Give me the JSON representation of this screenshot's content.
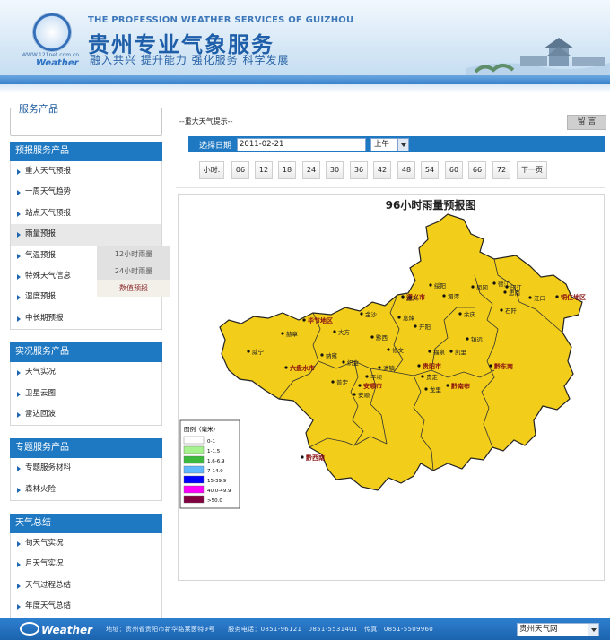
{
  "header": {
    "site_url": "WWW.121net.com.cn",
    "logo_text": "Weather",
    "title_en": "THE PROFESSION WEATHER SERVICES OF GUIZHOU",
    "title_cn": "贵州专业气象服务",
    "slogan": "融入共兴 提升能力 强化服务 科学发展"
  },
  "sidebar": {
    "service_box_title": "服务产品",
    "sections": [
      {
        "title": "预报服务产品",
        "items": [
          "重大天气预报",
          "一周天气趋势",
          "站点天气预报",
          "雨量预报",
          "气温预报",
          "特殊天气信息",
          "湿度预报",
          "中长期预报"
        ]
      },
      {
        "title": "实况服务产品",
        "items": [
          "天气实况",
          "卫星云图",
          "雷达回波"
        ]
      },
      {
        "title": "专题服务产品",
        "items": [
          "专题服务材料",
          "森林火险"
        ]
      },
      {
        "title": "天气总结",
        "items": [
          "旬天气实况",
          "月天气实况",
          "天气过程总结",
          "年度天气总结"
        ]
      }
    ],
    "flyout": [
      "12小时雨量",
      "24小时雨量",
      "数值预报"
    ]
  },
  "main": {
    "breadcrumb": "--重大天气提示--",
    "message_button": "留 言",
    "date_label": "选择日期",
    "date_value": "2011-02-21",
    "period_value": "上午",
    "hours_label": "小时:",
    "hours": [
      "06",
      "12",
      "18",
      "24",
      "30",
      "36",
      "42",
      "48",
      "54",
      "60",
      "66",
      "72"
    ],
    "next_page": "下一页"
  },
  "map": {
    "title": "96小时雨量预报图",
    "legend_title": "图例（毫米）",
    "legend": [
      {
        "label": "0-1",
        "color": "#ffffff"
      },
      {
        "label": "1-1.5",
        "color": "#a6f28f"
      },
      {
        "label": "1.6-6.9",
        "color": "#3dba3d"
      },
      {
        "label": "7-14.9",
        "color": "#61b8ff"
      },
      {
        "label": "15-39.9",
        "color": "#0000fe"
      },
      {
        "label": "40.0-49.9",
        "color": "#fa00fa"
      },
      {
        "label": ">50.0",
        "color": "#800040"
      }
    ],
    "region_fill": "#f2cd1a",
    "prefectures": [
      "毕节地区",
      "遵义市",
      "铜仁地区",
      "六盘水市",
      "黔东南",
      "安顺市",
      "贵阳市",
      "黔南布",
      "黔西南"
    ],
    "counties": [
      "绥阳",
      "凤冈",
      "遵义",
      "湄潭",
      "思南",
      "石阡",
      "印江",
      "余庆",
      "江口",
      "德江",
      "金沙",
      "赫章",
      "大方",
      "黔西",
      "威宁",
      "纳雍",
      "织金",
      "修文",
      "开阳",
      "息烽",
      "清镇",
      "普定",
      "安顺",
      "平坝",
      "龙里",
      "贵定",
      "福泉",
      "凯里",
      "镇远"
    ]
  },
  "footer": {
    "logo_text": "Weather",
    "address": "地址：贵州省贵阳市新华路莱茵特9号　　服务电话：0851-96121　0851-5531401　传真：0851-5509960",
    "select_value": "贵州天气网"
  }
}
